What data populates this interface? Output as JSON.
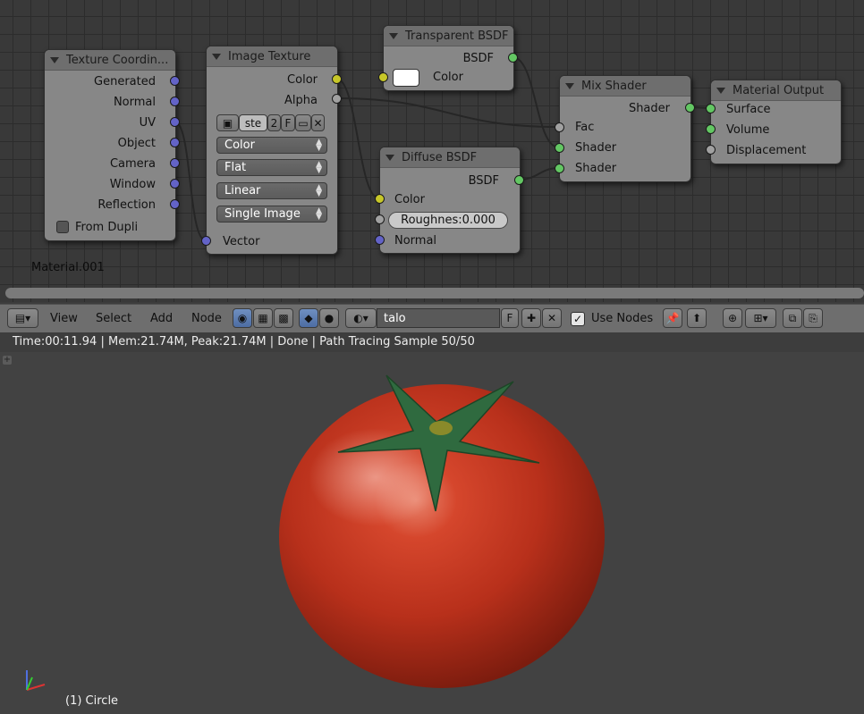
{
  "material_label": "Material.001",
  "nodes": {
    "tex_coord": {
      "title": "Texture Coordin...",
      "outputs": [
        "Generated",
        "Normal",
        "UV",
        "Object",
        "Camera",
        "Window",
        "Reflection"
      ],
      "checkbox_label": "From Dupli"
    },
    "image_texture": {
      "title": "Image Texture",
      "outputs": [
        "Color",
        "Alpha"
      ],
      "image_name": "ste",
      "user_count": "2",
      "fake_user": "F",
      "dropdowns": [
        "Color",
        "Flat",
        "Linear",
        "Single Image"
      ],
      "input": "Vector"
    },
    "transparent": {
      "title": "Transparent BSDF",
      "output": "BSDF",
      "input": "Color"
    },
    "diffuse": {
      "title": "Diffuse BSDF",
      "output": "BSDF",
      "inputs": [
        "Color",
        "Normal"
      ],
      "roughness": "Roughnes:0.000"
    },
    "mix": {
      "title": "Mix Shader",
      "output": "Shader",
      "inputs": [
        "Fac",
        "Shader",
        "Shader"
      ]
    },
    "output": {
      "title": "Material Output",
      "inputs": [
        "Surface",
        "Volume",
        "Displacement"
      ]
    }
  },
  "header": {
    "menus": [
      "View",
      "Select",
      "Add",
      "Node"
    ],
    "material_name": "talo",
    "fake_user": "F",
    "use_nodes_label": "Use Nodes"
  },
  "status_text": "Time:00:11.94 | Mem:21.74M, Peak:21.74M | Done | Path Tracing Sample 50/50",
  "viewport": {
    "object_label": "(1) Circle"
  },
  "colors": {
    "socket_shader": "#63c763",
    "socket_color": "#c7c729",
    "socket_vector": "#6363c7",
    "socket_float": "#a1a1a1",
    "tomato": "#c0301a"
  }
}
